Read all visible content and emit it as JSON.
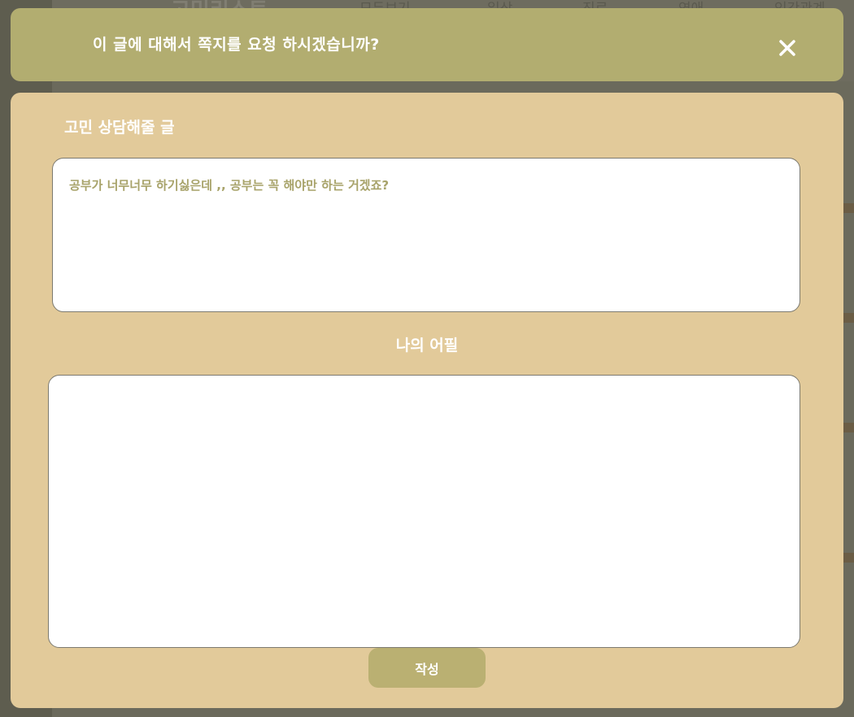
{
  "background": {
    "logo_text": "고민리스트",
    "nav_items": [
      "모두보기",
      "일상",
      "진로",
      "연애",
      "인간관계"
    ]
  },
  "modal": {
    "title": "이 글에 대해서 쪽지를 요청 하시겠습니까?",
    "close_icon": "close-icon",
    "post_section_label": "고민 상담해줄 글",
    "post_content": "공부가 너무너무 하기싫은데 ,, 공부는 꼭 해야만 하는 거겠죠?",
    "appeal_section_label": "나의 어필",
    "appeal_value": "",
    "appeal_placeholder": "",
    "submit_label": "작성"
  },
  "colors": {
    "header_bg": "#b2ad70",
    "body_bg": "#e2ca9a",
    "post_text": "#a8a36a",
    "submit_bg": "#bab072"
  }
}
